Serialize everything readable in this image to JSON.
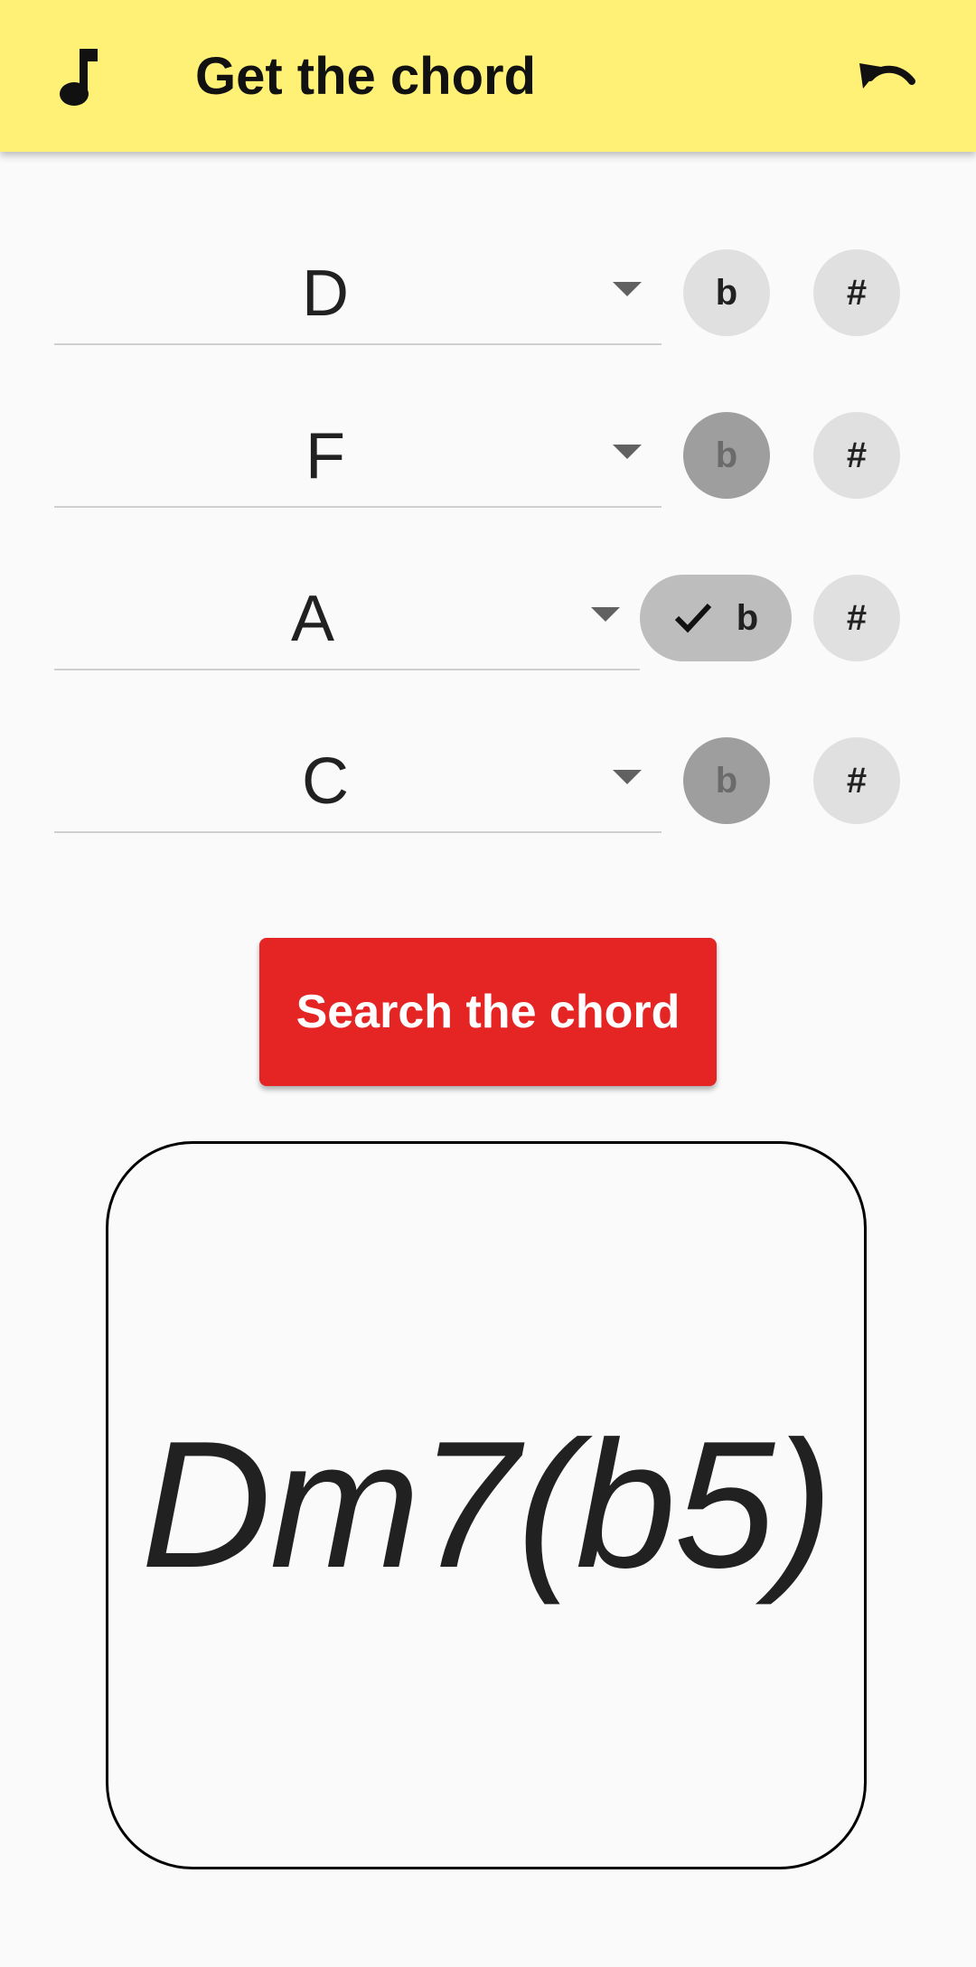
{
  "app": {
    "title": "Get the chord",
    "leading_icon": "music-note-icon",
    "trailing_icon": "undo-icon",
    "colors": {
      "appbar": "#fff176",
      "accent": "#e52424",
      "background": "#fafafa"
    }
  },
  "notes": [
    {
      "value": "D",
      "flat_label": "b",
      "sharp_label": "#",
      "flat_state": "enabled",
      "sharp_state": "enabled"
    },
    {
      "value": "F",
      "flat_label": "b",
      "sharp_label": "#",
      "flat_state": "disabled",
      "sharp_state": "enabled"
    },
    {
      "value": "A",
      "flat_label": "b",
      "sharp_label": "#",
      "flat_state": "selected",
      "sharp_state": "enabled"
    },
    {
      "value": "C",
      "flat_label": "b",
      "sharp_label": "#",
      "flat_state": "disabled",
      "sharp_state": "enabled"
    }
  ],
  "search_button": {
    "label": "Search the chord"
  },
  "result": {
    "chord": "Dm7(b5)"
  }
}
